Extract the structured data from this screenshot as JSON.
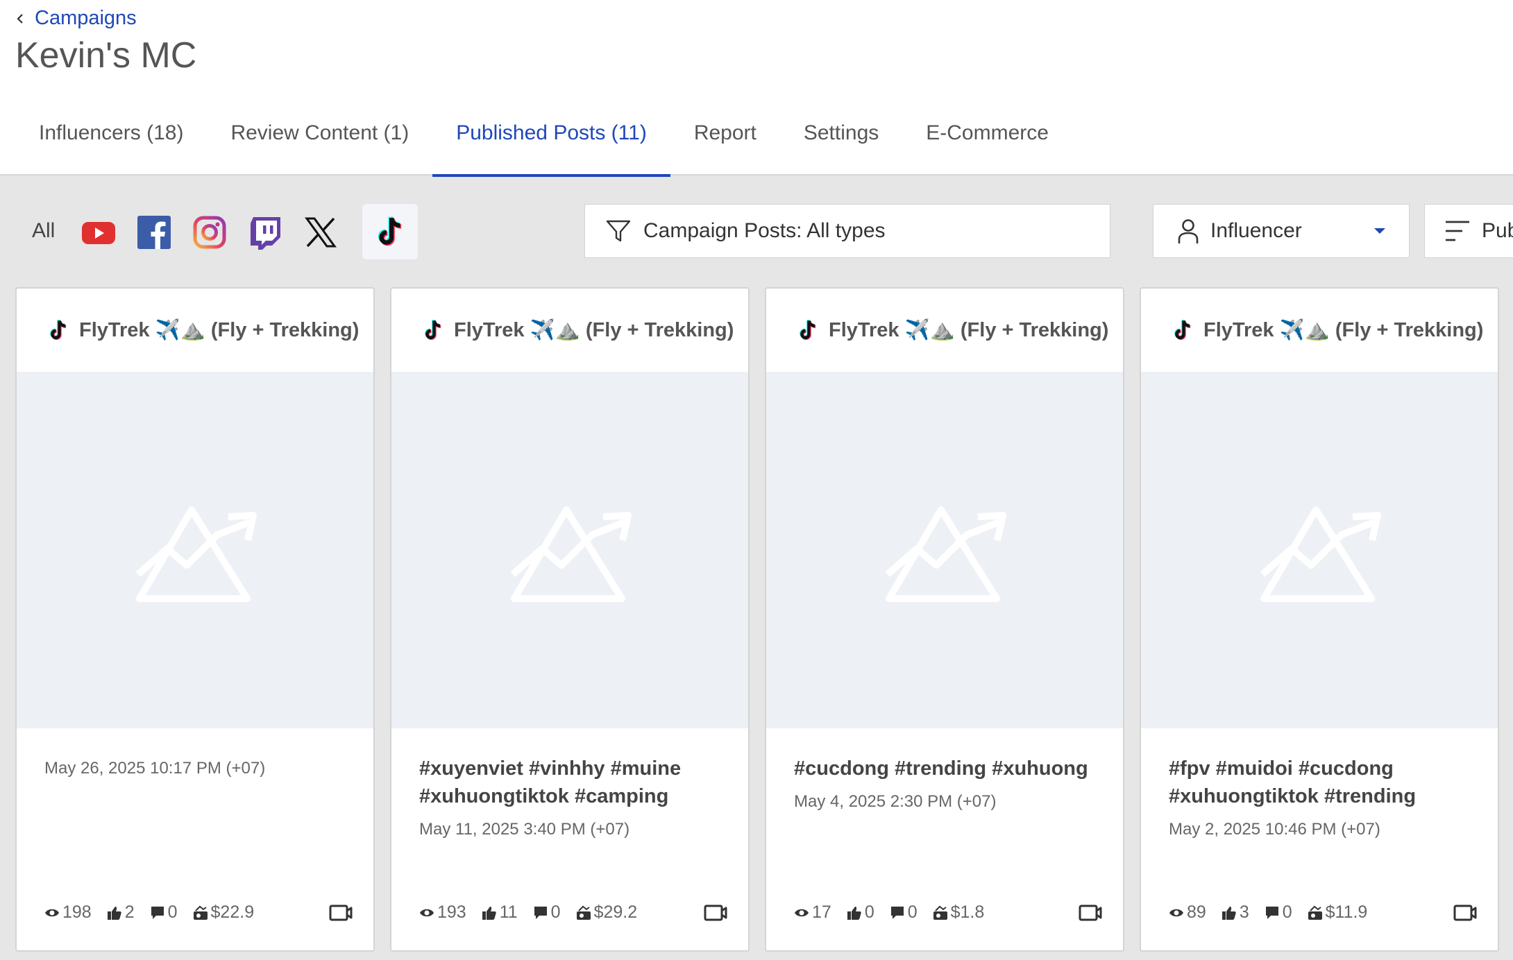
{
  "breadcrumb": {
    "label": "Campaigns"
  },
  "page": {
    "title": "Kevin's MC"
  },
  "tabs": [
    {
      "label": "Influencers (18)"
    },
    {
      "label": "Review Content (1)"
    },
    {
      "label": "Published Posts (11)"
    },
    {
      "label": "Report"
    },
    {
      "label": "Settings"
    },
    {
      "label": "E-Commerce"
    }
  ],
  "filters": {
    "all_label": "All",
    "platforms": [
      "youtube-icon",
      "facebook-icon",
      "instagram-icon",
      "twitch-icon",
      "x-icon",
      "tiktok-icon"
    ],
    "selected_platform": "tiktok",
    "post_type": "Campaign Posts: All types",
    "influencer": "Influencer",
    "sort": "Pub"
  },
  "colors": {
    "accent": "#1f47b8",
    "youtube": "#e0302f",
    "facebook": "#3b5da7",
    "twitch": "#6441a5"
  },
  "cards": [
    {
      "author": "FlyTrek ✈️⛰️ (Fly + Trekking)",
      "description": "",
      "date": "May 26, 2025 10:17 PM (+07)",
      "views": "198",
      "likes": "2",
      "comments": "0",
      "value": "$22.9"
    },
    {
      "author": "FlyTrek ✈️⛰️ (Fly + Trekking)",
      "description": "#xuyenviet #vinhhy #muine #xuhuongtiktok #camping",
      "date": "May 11, 2025 3:40 PM (+07)",
      "views": "193",
      "likes": "11",
      "comments": "0",
      "value": "$29.2"
    },
    {
      "author": "FlyTrek ✈️⛰️ (Fly + Trekking)",
      "description": "#cucdong #trending #xuhuong",
      "date": "May 4, 2025 2:30 PM (+07)",
      "views": "17",
      "likes": "0",
      "comments": "0",
      "value": "$1.8"
    },
    {
      "author": "FlyTrek ✈️⛰️ (Fly + Trekking)",
      "description": "#fpv #muidoi #cucdong #xuhuongtiktok #trending",
      "date": "May 2, 2025 10:46 PM (+07)",
      "views": "89",
      "likes": "3",
      "comments": "0",
      "value": "$11.9"
    }
  ]
}
